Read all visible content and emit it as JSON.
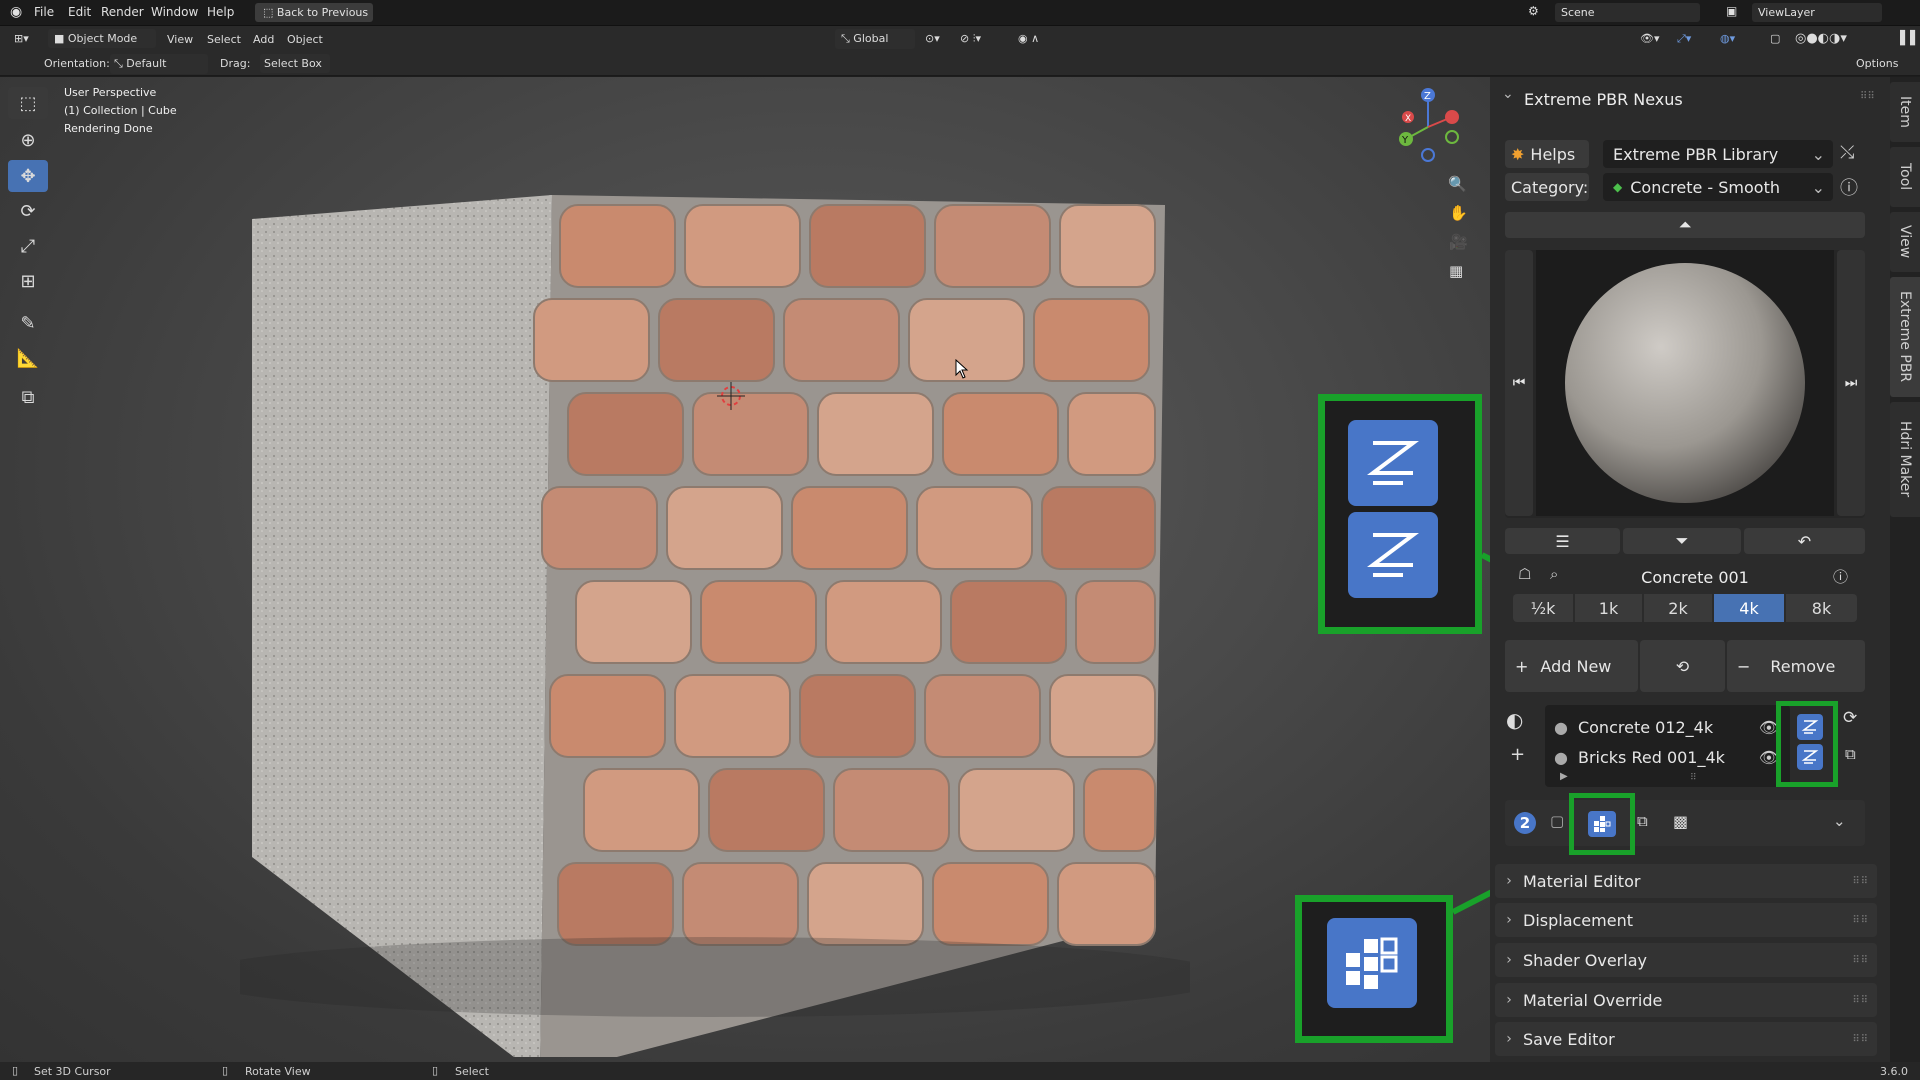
{
  "menubar": {
    "items": [
      "File",
      "Edit",
      "Render",
      "Window",
      "Help"
    ],
    "back_button": "Back to Previous",
    "scene_label": "Scene",
    "viewlayer_label": "ViewLayer"
  },
  "header": {
    "mode": "Object Mode",
    "menus": [
      "View",
      "Select",
      "Add",
      "Object"
    ],
    "transform_orientation": "Global",
    "options_label": "Options"
  },
  "tool_options": {
    "orientation_label": "Orientation:",
    "orientation_value": "Default",
    "drag_label": "Drag:",
    "drag_value": "Select Box"
  },
  "viewport": {
    "info_line1": "User Perspective",
    "info_line2": "(1) Collection | Cube",
    "info_line3": "Rendering Done"
  },
  "panel": {
    "title": "Extreme PBR Nexus",
    "helps_label": "Helps",
    "library_value": "Extreme PBR Library",
    "category_label": "Category:",
    "category_value": "Concrete - Smooth",
    "material_name": "Concrete 001",
    "resolutions": [
      "½k",
      "1k",
      "2k",
      "4k",
      "8k"
    ],
    "active_resolution": "4k",
    "add_new_label": "Add New",
    "remove_label": "Remove",
    "materials": [
      {
        "name": "Concrete 012_4k"
      },
      {
        "name": "Bricks Red 001_4k"
      }
    ],
    "slot_count": "2",
    "sections": [
      "Material Editor",
      "Displacement",
      "Shader Overlay",
      "Material Override",
      "Save Editor"
    ]
  },
  "side_tabs": [
    "Item",
    "Tool",
    "View",
    "Extreme PBR",
    "Hdri Maker"
  ],
  "statusbar": {
    "left": "Set 3D Cursor",
    "middle": "Rotate View",
    "right": "Select",
    "version": "3.6.0"
  },
  "colors": {
    "accent": "#4772b3",
    "highlight_green": "#19a12a",
    "brick": "#c98a6e"
  }
}
